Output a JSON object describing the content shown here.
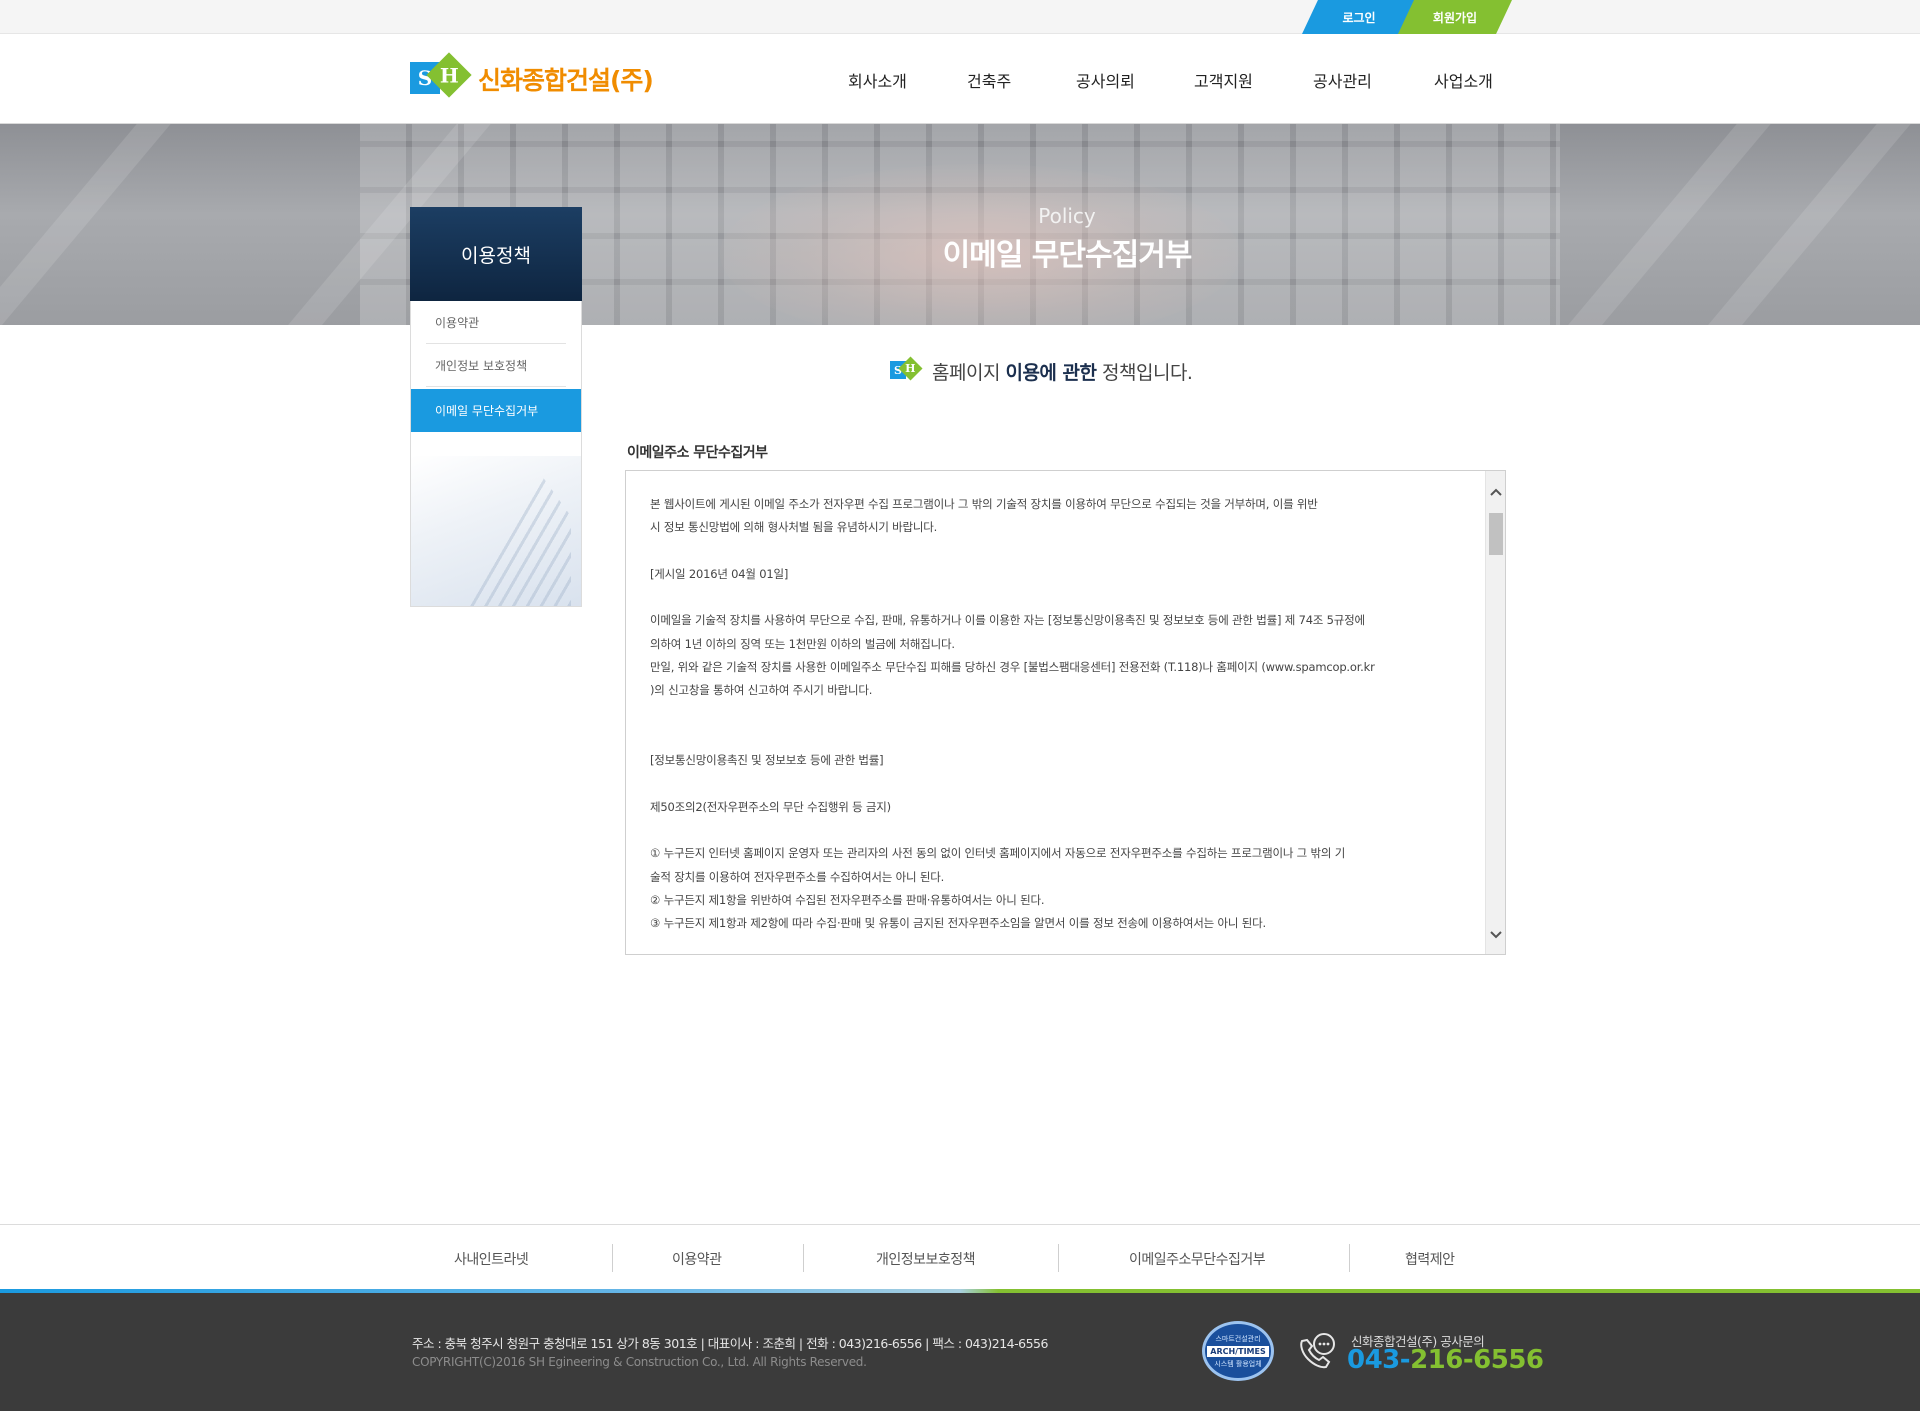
{
  "colors": {
    "primary_blue": "#1a9ae0",
    "accent_green": "#84c031",
    "logo_orange": "#f08c00",
    "navy": "#1c3e63",
    "footer_bg": "#3b3b3b"
  },
  "topbar": {
    "login": "로그인",
    "join": "회원가입"
  },
  "header": {
    "logo_mark_s": "S",
    "logo_mark_h": "H",
    "logo_text": "신화종합건설(주)",
    "nav": [
      "회사소개",
      "건축주",
      "공사의뢰",
      "고객지원",
      "공사관리",
      "사업소개"
    ]
  },
  "hero": {
    "subtitle": "Policy",
    "title": "이메일 무단수집거부"
  },
  "sidebar": {
    "title": "이용정책",
    "items": [
      {
        "label": "이용약관",
        "active": false
      },
      {
        "label": "개인정보 보호정책",
        "active": false
      },
      {
        "label": "이메일 무단수집거부",
        "active": true
      }
    ]
  },
  "content": {
    "intro_pre": "홈페이지 ",
    "intro_strong": "이용에 관한",
    "intro_post": " 정책입니다.",
    "section_title": "이메일주소 무단수집거부",
    "policy_lines": [
      "본 웹사이트에 게시된 이메일 주소가 전자우편 수집 프로그램이나 그 밖의 기술적 장치를 이용하여 무단으로 수집되는 것을 거부하며, 이를 위반",
      "시 정보 통신망법에 의해 형사처벌 됨을 유념하시기 바랍니다.",
      "",
      "[게시일 2016년 04월 01일]",
      "",
      "이메일을 기술적 장치를 사용하여 무단으로 수집, 판매, 유통하거나 이를 이용한 자는 [정보통신망이용촉진 및 정보보호 등에 관한 법률] 제 74조 5규정에",
      "의하여 1년 이하의 징역 또는 1천만원 이하의 벌금에 처해집니다.",
      "만일, 위와 같은 기술적 장치를 사용한 이메일주소 무단수집 피해를 당하신 경우 [불법스팸대응센터] 전용전화 (T.118)나 홈페이지 (www.spamcop.or.kr",
      ")의 신고창을 통하여 신고하여 주시기 바랍니다.",
      "",
      "",
      "[정보통신망이용촉진 및 정보보호 등에 관한 법률]",
      "",
      "제50조의2(전자우편주소의 무단 수집행위 등 금지)",
      "",
      "① 누구든지 인터넷 홈페이지 운영자 또는 관리자의 사전 동의 없이 인터넷 홈페이지에서 자동으로 전자우편주소를 수집하는 프로그램이나 그 밖의 기",
      "술적 장치를 이용하여 전자우편주소를 수집하여서는 아니 된다.",
      "② 누구든지 제1항을 위반하여 수집된 전자우편주소를 판매·유통하여서는 아니 된다.",
      "③ 누구든지 제1항과 제2항에 따라 수집·판매 및 유통이 금지된 전자우편주소임을 알면서 이를 정보 전송에 이용하여서는 아니 된다."
    ]
  },
  "footer_links": [
    "사내인트라넷",
    "이용약관",
    "개인정보보호정책",
    "이메일주소무단수집거부",
    "협력제안"
  ],
  "footer": {
    "address": "주소 : 충북 청주시 청원구 충청대로 151 상가 8동 301호   |   대표이사 : 조춘희   |   전화 : 043)216-6556   |   팩스 : 043)214-6556",
    "copyright": "COPYRIGHT(C)2016  SH Egineering & Construction  Co., Ltd. All Rights Reserved.",
    "badge_top": "스마트건설관리",
    "badge_mid": "ARCH/TIMES",
    "badge_bottom": "시스템 활용업체",
    "cs_label": "신화종합건설(주) 공사문의",
    "cs_phone_a": "043-",
    "cs_phone_b": "216-6556"
  },
  "icons": {
    "scroll_up": "chevron-up-icon",
    "scroll_down": "chevron-down-icon",
    "phone": "phone-chat-icon"
  }
}
